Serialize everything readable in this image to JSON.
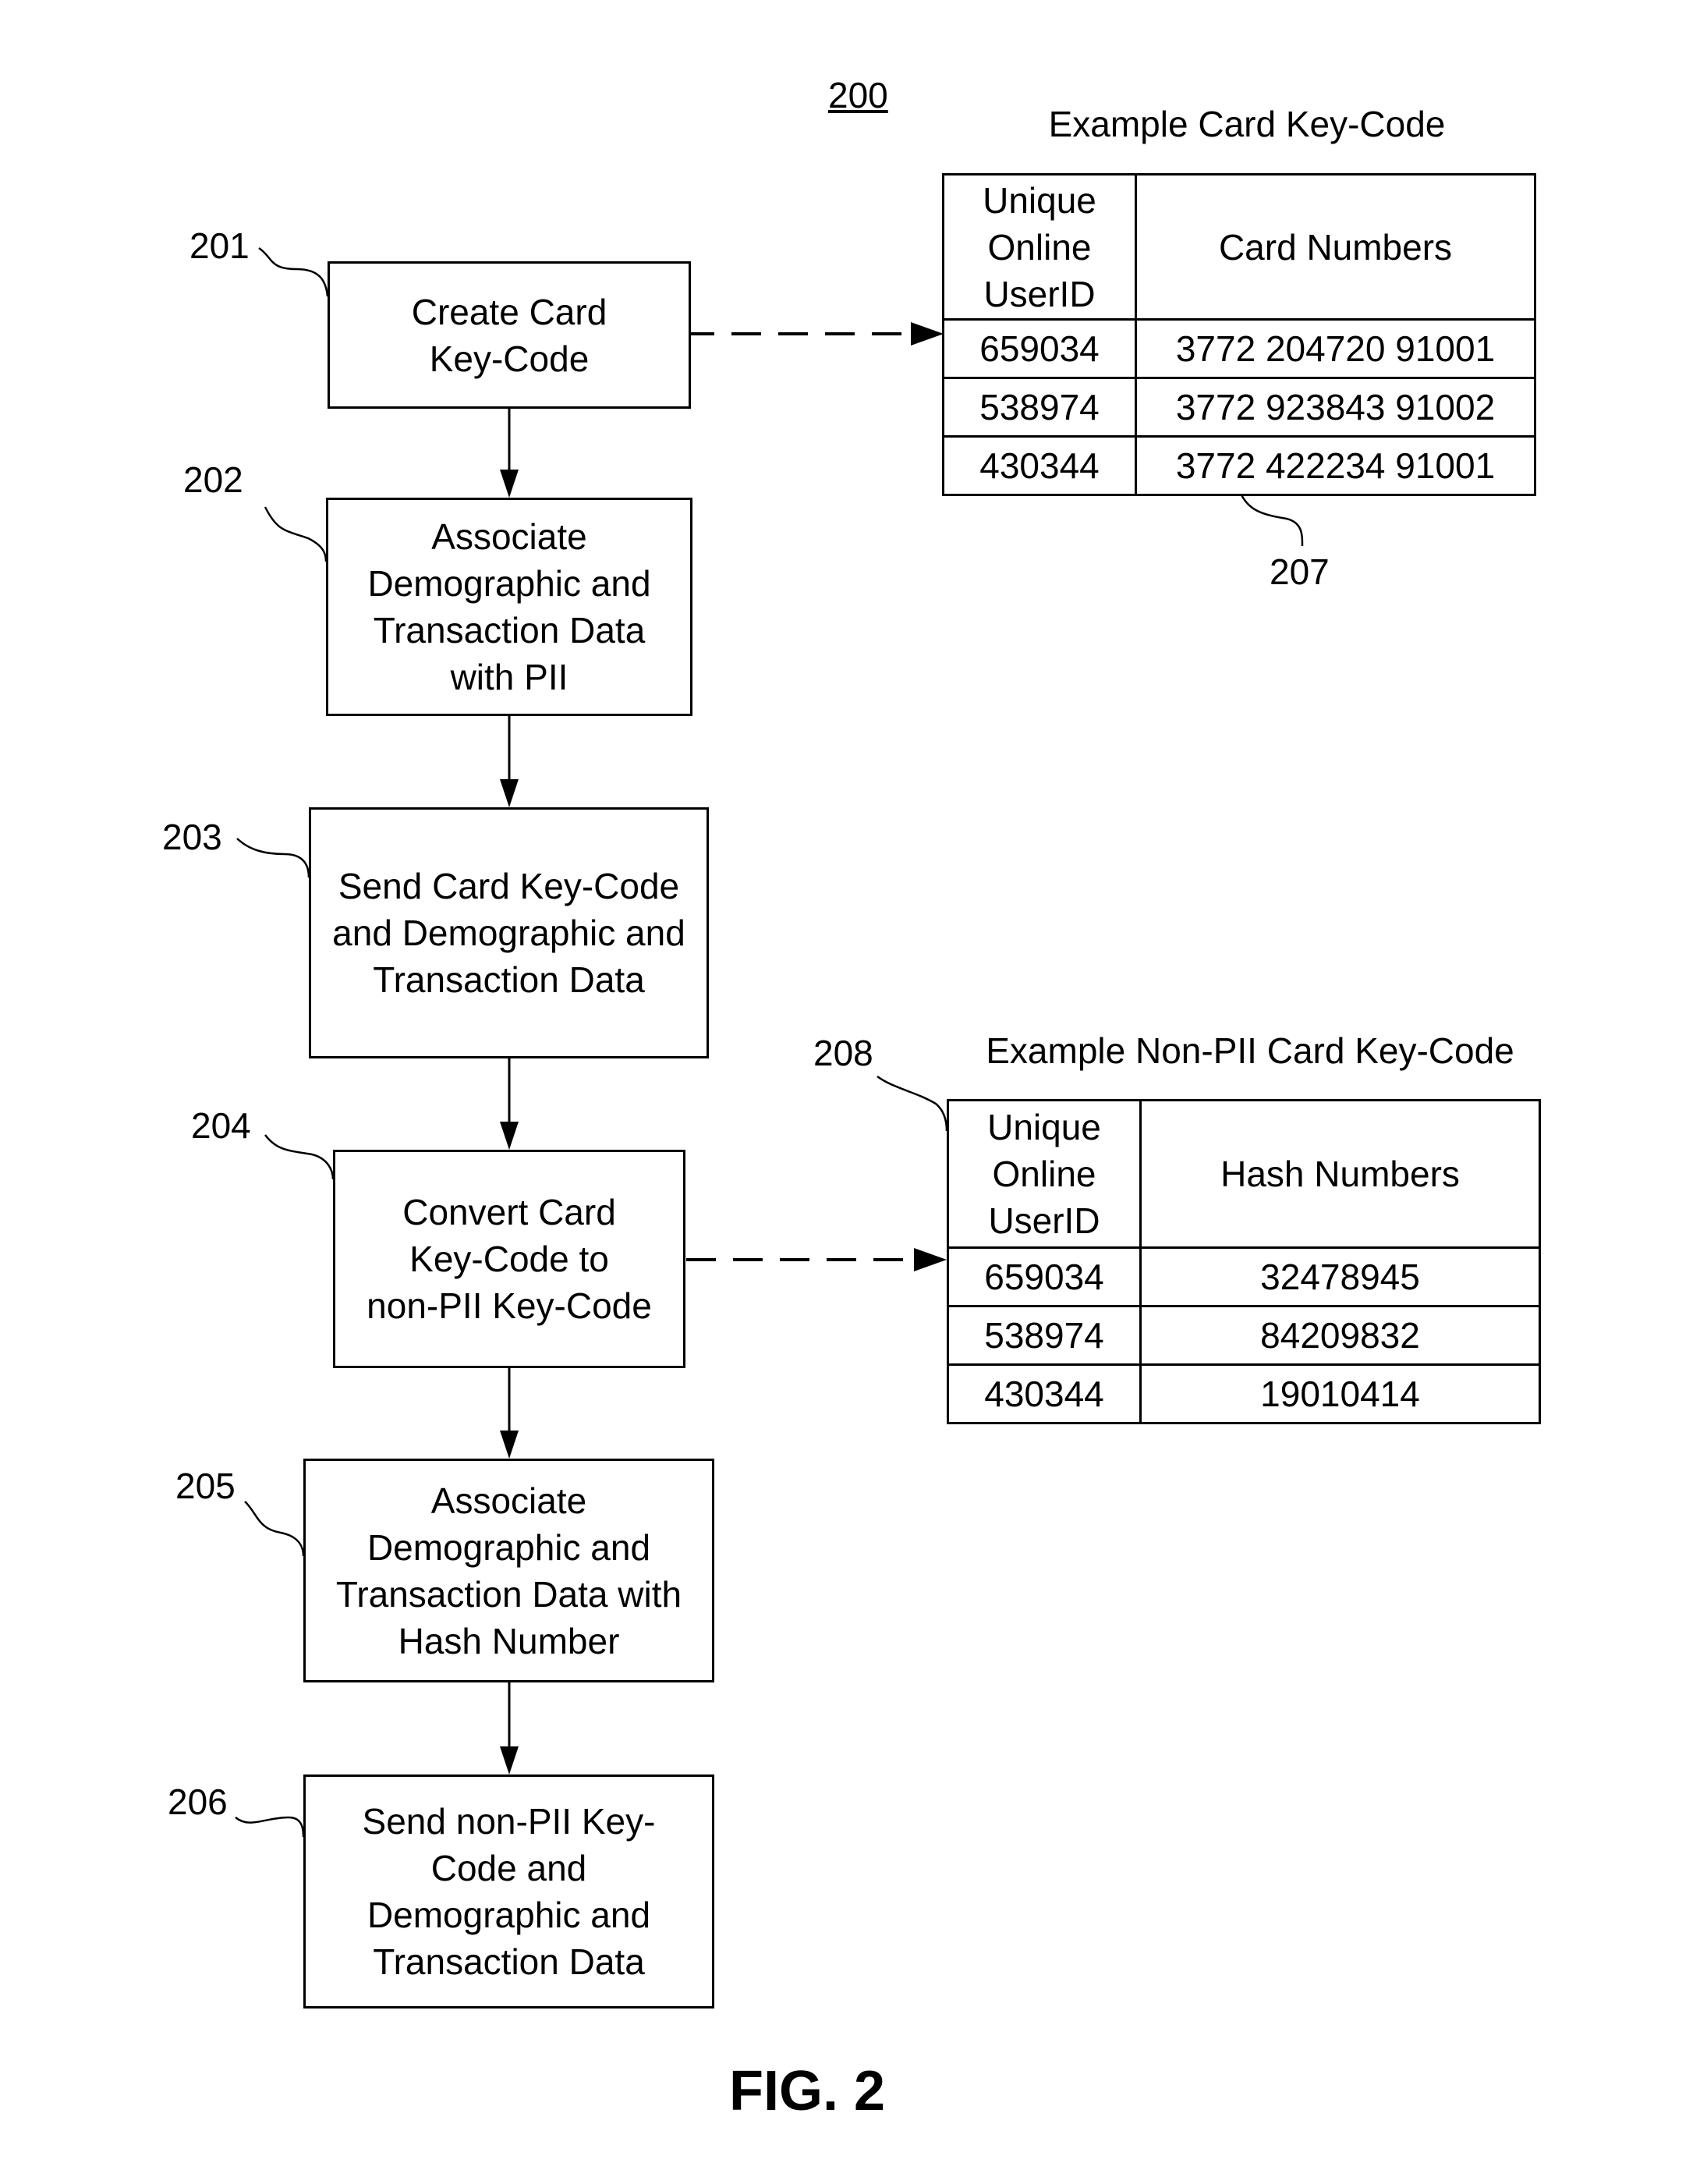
{
  "figure": {
    "number": "200",
    "caption": "FIG. 2"
  },
  "steps": [
    {
      "ref": "201",
      "text": "Create Card\nKey-Code"
    },
    {
      "ref": "202",
      "text": "Associate\nDemographic and\nTransaction Data\nwith PII"
    },
    {
      "ref": "203",
      "text": "Send Card Key-Code\nand Demographic and\nTransaction Data"
    },
    {
      "ref": "204",
      "text": "Convert Card\nKey-Code to\nnon-PII Key-Code"
    },
    {
      "ref": "205",
      "text": "Associate\nDemographic and\nTransaction Data with\nHash Number"
    },
    {
      "ref": "206",
      "text": "Send non-PII Key-\nCode and\nDemographic and\nTransaction Data"
    }
  ],
  "card_table": {
    "ref": "207",
    "title": "Example Card Key-Code",
    "headers": [
      "Unique\nOnline\nUserID",
      "Card Numbers"
    ],
    "rows": [
      [
        "659034",
        "3772 204720 91001"
      ],
      [
        "538974",
        "3772 923843 91002"
      ],
      [
        "430344",
        "3772 422234 91001"
      ]
    ]
  },
  "hash_table": {
    "ref": "208",
    "title": "Example Non-PII Card Key-Code",
    "headers": [
      "Unique\nOnline\nUserID",
      "Hash Numbers"
    ],
    "rows": [
      [
        "659034",
        "32478945"
      ],
      [
        "538974",
        "84209832"
      ],
      [
        "430344",
        "19010414"
      ]
    ]
  },
  "connections": [
    {
      "from": "201",
      "to": "202",
      "style": "solid"
    },
    {
      "from": "202",
      "to": "203",
      "style": "solid"
    },
    {
      "from": "203",
      "to": "204",
      "style": "solid"
    },
    {
      "from": "204",
      "to": "205",
      "style": "solid"
    },
    {
      "from": "205",
      "to": "206",
      "style": "solid"
    },
    {
      "from": "201",
      "to": "207",
      "style": "dashed"
    },
    {
      "from": "204",
      "to": "208",
      "style": "dashed"
    }
  ]
}
